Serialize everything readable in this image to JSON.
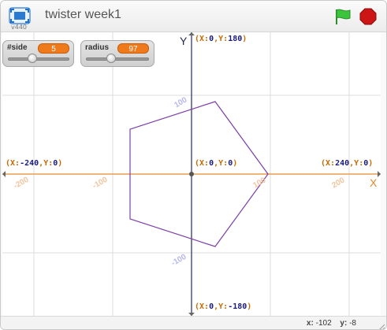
{
  "window": {
    "title": "twister week1",
    "version": "v440"
  },
  "icons": {
    "fullscreen": "fullscreen-icon",
    "green_flag": "green-flag-icon",
    "stop": "stop-sign-icon",
    "resize": "resize-grip-icon"
  },
  "colors": {
    "x_axis": "#e38a2b",
    "y_axis": "#222a55",
    "polygon": "#7b3fa8",
    "flag": "#3cc43c",
    "stop": "#cc1515",
    "variable": "#ef7a1c"
  },
  "monitors": [
    {
      "label": "#side",
      "value": "5",
      "slider_fraction": 0.4
    },
    {
      "label": "radius",
      "value": "97",
      "slider_fraction": 0.4
    }
  ],
  "stage": {
    "x_axis_letter": "X",
    "y_axis_letter": "Y",
    "labels": {
      "top": {
        "p1": "(",
        "k1": "X:",
        "v1": "0",
        "c": ",",
        "k2": "Y:",
        "v2": "180",
        "p2": ")"
      },
      "bottom": {
        "p1": "(",
        "k1": "X:",
        "v1": "0",
        "c": ",",
        "k2": "Y:",
        "v2": "-180",
        "p2": ")"
      },
      "left": {
        "p1": "(",
        "k1": "X:",
        "v1": "-240",
        "c": ",",
        "k2": "Y:",
        "v2": "0",
        "p2": ")"
      },
      "right": {
        "p1": "(",
        "k1": "X:",
        "v1": "240",
        "c": ",",
        "k2": "Y:",
        "v2": "0",
        "p2": ")"
      },
      "center": {
        "p1": "(",
        "k1": "X:",
        "v1": "0",
        "c": ",",
        "k2": "Y:",
        "v2": "0",
        "p2": ")"
      }
    },
    "x_ticks": [
      "-200",
      "-100",
      "100",
      "200"
    ],
    "y_ticks": [
      "100",
      "-100"
    ],
    "grid": true
  },
  "chart_data": {
    "type": "scatter",
    "xlim": [
      -240,
      240
    ],
    "ylim": [
      -180,
      180
    ],
    "polygon": {
      "sides": 5,
      "radius": 97,
      "vertices": [
        [
          97,
          0
        ],
        [
          30,
          92
        ],
        [
          -78,
          57
        ],
        [
          -78,
          -57
        ],
        [
          30,
          -92
        ]
      ]
    }
  },
  "footer": {
    "x_label": "x:",
    "x_value": "-102",
    "y_label": "y:",
    "y_value": "-8"
  }
}
